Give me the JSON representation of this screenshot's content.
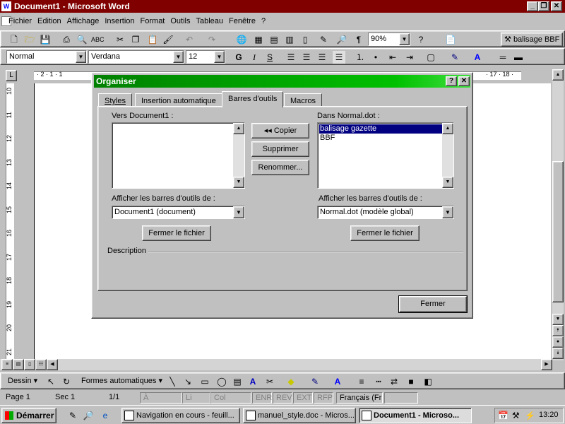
{
  "window": {
    "title": "Document1 - Microsoft Word"
  },
  "menu": {
    "items": [
      "Fichier",
      "Edition",
      "Affichage",
      "Insertion",
      "Format",
      "Outils",
      "Tableau",
      "Fenêtre",
      "?"
    ]
  },
  "toolbar_standard": {
    "zoom": "90%",
    "custom_button": "balisage BBF"
  },
  "toolbar_format": {
    "style": "Normal",
    "font": "Verdana",
    "size": "12",
    "bold": "G",
    "italic": "I",
    "underline": "S"
  },
  "ruler": {
    "left": "· 2 · 1 · 1",
    "right": "· 17 · 18 ·"
  },
  "vruler": {
    "marks": [
      "10",
      "11",
      "12",
      "13",
      "14",
      "15",
      "16",
      "17",
      "18",
      "19",
      "20",
      "21"
    ]
  },
  "dialog": {
    "title": "Organiser",
    "tabs": [
      "Styles",
      "Insertion automatique",
      "Barres d'outils",
      "Macros"
    ],
    "left_list_label": "Vers Document1 :",
    "right_list_label": "Dans Normal.dot :",
    "right_list_items": [
      "balisage gazette",
      "BBF"
    ],
    "copy_button": "◂◂ Copier",
    "delete_button": "Supprimer",
    "rename_button": "Renommer...",
    "left_show_label": "Afficher les barres d'outils de :",
    "right_show_label": "Afficher les barres d'outils de :",
    "left_source": "Document1 (document)",
    "right_source": "Normal.dot (modèle global)",
    "left_close_file": "Fermer le fichier",
    "right_close_file": "Fermer le fichier",
    "description_label": "Description",
    "close_button": "Fermer"
  },
  "drawing": {
    "draw_label": "Dessin",
    "autoshapes_label": "Formes automatiques"
  },
  "status": {
    "page": "Page  1",
    "sec": "Sec  1",
    "pages": "1/1",
    "at": "À",
    "li": "Li",
    "col": "Col",
    "enr": "ENR",
    "rev": "REV",
    "ext": "EXT",
    "rfp": "RFP",
    "lang": "Français (Fr"
  },
  "taskbar": {
    "start": "Démarrer",
    "tasks": [
      "Navigation en cours - feuill...",
      "manuel_style.doc - Micros...",
      "Document1 - Microso..."
    ],
    "clock": "13:20"
  }
}
